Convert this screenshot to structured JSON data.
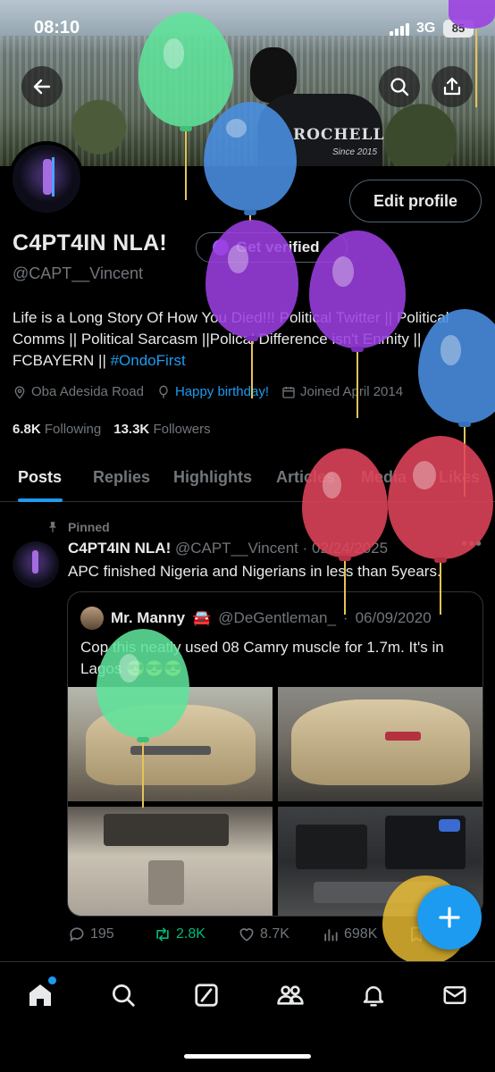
{
  "status_bar": {
    "time": "08:10",
    "network": "3G",
    "battery": "85"
  },
  "header": {
    "back_icon": "arrow-left-icon",
    "search_icon": "search-icon",
    "share_icon": "share-icon",
    "banner_shirt_text": "ROCHELL",
    "banner_shirt_since": "Since 2015"
  },
  "profile": {
    "edit_label": "Edit profile",
    "name": "C4PT4IN NLA!",
    "verified_label": "Get verified",
    "handle": "@CAPT__Vincent",
    "bio_text": "Life is a Long Story Of How You Died!!! Political Twitter || Political Comms || Political Sarcasm ||Polical Difference isn't Enmity || FCBAYERN || ",
    "bio_hashtag": "#OndoFirst",
    "location": "Oba Adesida Road",
    "birthday": "Happy birthday!",
    "joined": "Joined April 2014",
    "following_count": "6.8K",
    "following_label": "Following",
    "followers_count": "13.3K",
    "followers_label": "Followers"
  },
  "tabs": [
    "Posts",
    "Replies",
    "Highlights",
    "Articles",
    "Media",
    "Likes"
  ],
  "post": {
    "pinned_label": "Pinned",
    "author_name": "C4PT4IN NLA!",
    "author_handle": "@CAPT__Vincent",
    "date": "02/24/2025",
    "text": "APC finished Nigeria and Nigerians in less than 5years.",
    "quote": {
      "author_name": "Mr. Manny",
      "author_emoji": "🚘",
      "author_handle": "@DeGentleman_",
      "date": "06/09/2020",
      "text": "Cop this neatly used 08 Camry muscle for 1.7m. It's in Lagos 😎😎😎"
    },
    "replies": "195",
    "reposts": "2.8K",
    "likes": "8.7K",
    "views": "698K"
  },
  "fab_icon": "plus-icon",
  "bottom_nav": [
    "home-icon",
    "search-icon",
    "grok-icon",
    "communities-icon",
    "notifications-icon",
    "messages-icon"
  ],
  "colors": {
    "accent": "#1d9bf0",
    "background": "#000000",
    "muted": "#71767b",
    "repost": "#00ba7c",
    "balloon_green": "#5fe39a",
    "balloon_blue": "#4a90e2",
    "balloon_purple": "#9b3fe0",
    "balloon_red": "#e0435a",
    "balloon_yellow": "#f2c335"
  }
}
